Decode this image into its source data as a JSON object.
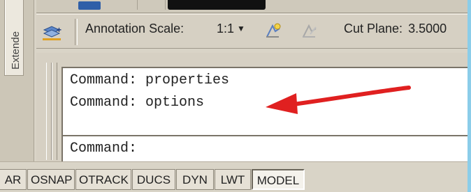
{
  "palette": {
    "tab_label": "Extende"
  },
  "annotation_bar": {
    "scale_label": "Annotation Scale:",
    "scale_value": "1:1",
    "cut_plane_label": "Cut Plane:",
    "cut_plane_value": "3.5000"
  },
  "command_window": {
    "history": [
      "Command: properties",
      "Command: options"
    ],
    "prompt": "Command:"
  },
  "status_bar": {
    "buttons": [
      "AR",
      "OSNAP",
      "OTRACK",
      "DUCS",
      "DYN",
      "LWT",
      "MODEL"
    ]
  },
  "colors": {
    "arrow": "#e02020",
    "background": "#7fc6e7"
  }
}
